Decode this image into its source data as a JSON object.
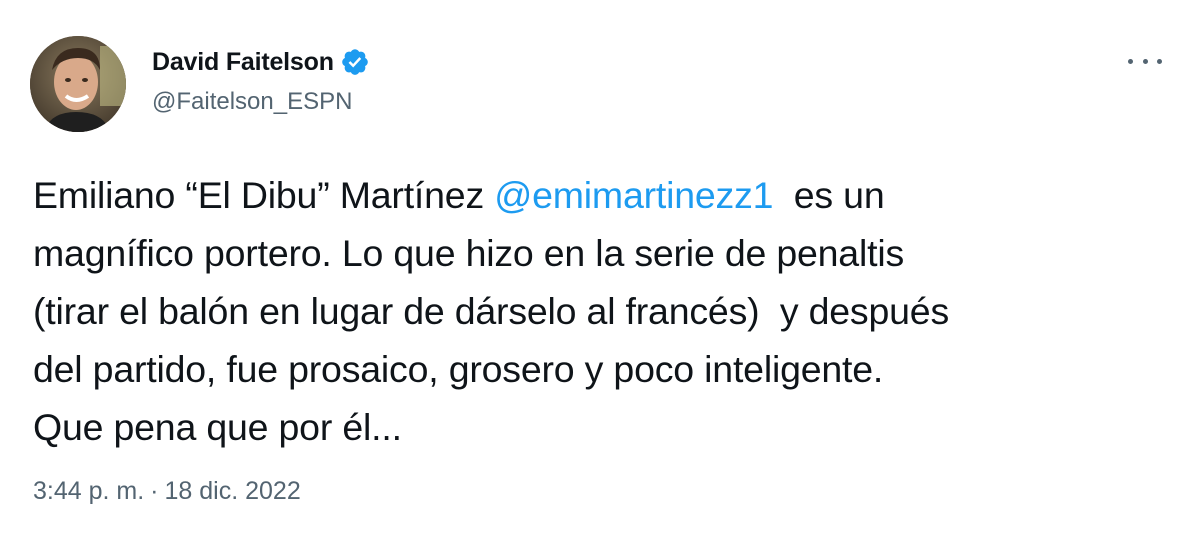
{
  "author": {
    "display_name": "David Faitelson",
    "handle": "@Faitelson_ESPN",
    "verified_icon": "verified-badge-icon",
    "avatar_icon": "profile-photo"
  },
  "menu": {
    "icon": "more-options-icon"
  },
  "tweet": {
    "line1_before": "Emiliano “El Dibu” Martínez ",
    "mention": "@emimartinezz1",
    "line1_after": "  es un",
    "line2": "magnífico portero. Lo que hizo en la serie de penaltis",
    "line3": "(tirar el balón en lugar de dárselo al francés)  y después",
    "line4": "del partido, fue prosaico, grosero y poco inteligente.",
    "line5": "Que pena que por él..."
  },
  "meta": {
    "time": "3:44 p. m.",
    "separator": "·",
    "date": "18 dic. 2022"
  },
  "colors": {
    "text": "#0f1419",
    "secondary": "#536471",
    "link": "#1d9bf0"
  }
}
